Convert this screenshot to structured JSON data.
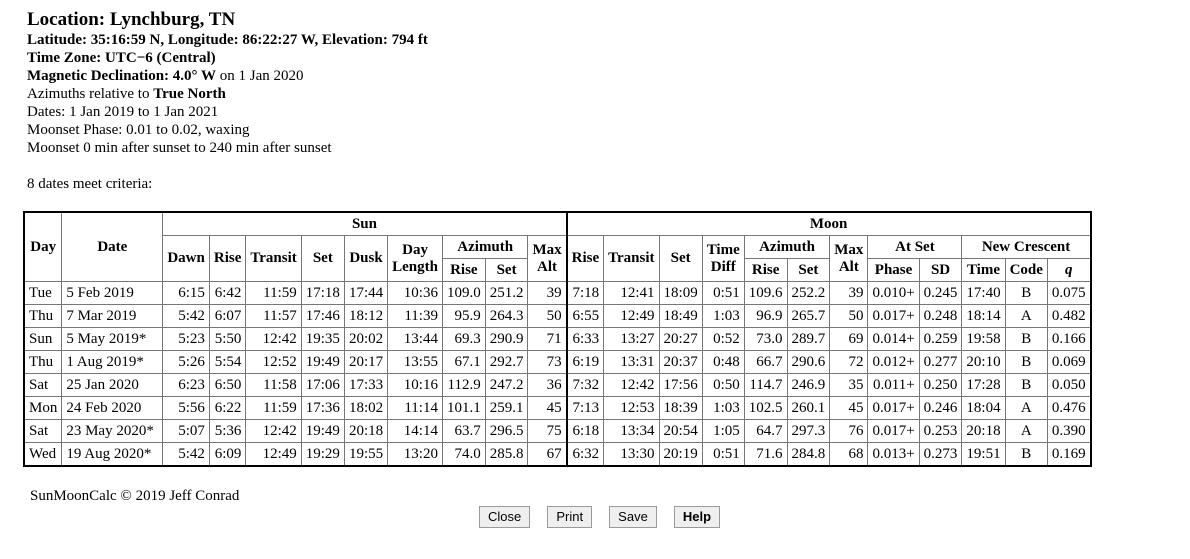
{
  "header": {
    "location": "Location: Lynchburg, TN",
    "coords": "Latitude: 35:16:59 N, Longitude: 86:22:27 W, Elevation: 794 ft",
    "timezone": "Time Zone: UTC−6 (Central)",
    "magdecl_label": "Magnetic Declination: 4.0° W",
    "magdecl_date": " on 1 Jan 2020",
    "azimuth_prefix": "Azimuths relative to ",
    "azimuth_ref": "True North",
    "dates": "Dates: 1 Jan 2019 to 1 Jan 2021",
    "moonset_phase": "Moonset Phase: 0.01 to 0.02, waxing",
    "moonset_window": "Moonset 0 min after sunset to 240 min after sunset"
  },
  "criteria": "8 dates meet criteria:",
  "table": {
    "groups": {
      "sun": "Sun",
      "moon": "Moon"
    },
    "headers": {
      "day": "Day",
      "date": "Date",
      "dawn": "Dawn",
      "rise": "Rise",
      "transit": "Transit",
      "set": "Set",
      "dusk": "Dusk",
      "day_length": [
        "Day",
        "Length"
      ],
      "azimuth": "Azimuth",
      "az_rise": "Rise",
      "az_set": "Set",
      "max_alt": [
        "Max",
        "Alt"
      ],
      "m_rise": "Rise",
      "m_transit": "Transit",
      "m_set": "Set",
      "time_diff": [
        "Time",
        "Diff"
      ],
      "m_azimuth": "Azimuth",
      "m_az_rise": "Rise",
      "m_az_set": "Set",
      "m_max_alt": [
        "Max",
        "Alt"
      ],
      "at_set": "At Set",
      "phase": "Phase",
      "sd": "SD",
      "new_crescent": "New Crescent",
      "nc_time": "Time",
      "nc_code": "Code",
      "nc_q": "q"
    },
    "rows": [
      [
        "Tue",
        "5 Feb 2019",
        "6:15",
        "6:42",
        "11:59",
        "17:18",
        "17:44",
        "10:36",
        "109.0",
        "251.2",
        "39",
        "7:18",
        "12:41",
        "18:09",
        "0:51",
        "109.6",
        "252.2",
        "39",
        "0.010+",
        "0.245",
        "17:40",
        "B",
        "0.075"
      ],
      [
        "Thu",
        "7 Mar 2019",
        "5:42",
        "6:07",
        "11:57",
        "17:46",
        "18:12",
        "11:39",
        "95.9",
        "264.3",
        "50",
        "6:55",
        "12:49",
        "18:49",
        "1:03",
        "96.9",
        "265.7",
        "50",
        "0.017+",
        "0.248",
        "18:14",
        "A",
        "0.482"
      ],
      [
        "Sun",
        "5 May 2019*",
        "5:23",
        "5:50",
        "12:42",
        "19:35",
        "20:02",
        "13:44",
        "69.3",
        "290.9",
        "71",
        "6:33",
        "13:27",
        "20:27",
        "0:52",
        "73.0",
        "289.7",
        "69",
        "0.014+",
        "0.259",
        "19:58",
        "B",
        "0.166"
      ],
      [
        "Thu",
        "1 Aug 2019*",
        "5:26",
        "5:54",
        "12:52",
        "19:49",
        "20:17",
        "13:55",
        "67.1",
        "292.7",
        "73",
        "6:19",
        "13:31",
        "20:37",
        "0:48",
        "66.7",
        "290.6",
        "72",
        "0.012+",
        "0.277",
        "20:10",
        "B",
        "0.069"
      ],
      [
        "Sat",
        "25 Jan 2020",
        "6:23",
        "6:50",
        "11:58",
        "17:06",
        "17:33",
        "10:16",
        "112.9",
        "247.2",
        "36",
        "7:32",
        "12:42",
        "17:56",
        "0:50",
        "114.7",
        "246.9",
        "35",
        "0.011+",
        "0.250",
        "17:28",
        "B",
        "0.050"
      ],
      [
        "Mon",
        "24 Feb 2020",
        "5:56",
        "6:22",
        "11:59",
        "17:36",
        "18:02",
        "11:14",
        "101.1",
        "259.1",
        "45",
        "7:13",
        "12:53",
        "18:39",
        "1:03",
        "102.5",
        "260.1",
        "45",
        "0.017+",
        "0.246",
        "18:04",
        "A",
        "0.476"
      ],
      [
        "Sat",
        "23 May 2020*",
        "5:07",
        "5:36",
        "12:42",
        "19:49",
        "20:18",
        "14:14",
        "63.7",
        "296.5",
        "75",
        "6:18",
        "13:34",
        "20:54",
        "1:05",
        "64.7",
        "297.3",
        "76",
        "0.017+",
        "0.253",
        "20:18",
        "A",
        "0.390"
      ],
      [
        "Wed",
        "19 Aug 2020*",
        "5:42",
        "6:09",
        "12:49",
        "19:29",
        "19:55",
        "13:20",
        "74.0",
        "285.8",
        "67",
        "6:32",
        "13:30",
        "20:19",
        "0:51",
        "71.6",
        "284.8",
        "68",
        "0.013+",
        "0.273",
        "19:51",
        "B",
        "0.169"
      ]
    ]
  },
  "footer": "SunMoonCalc © 2019 Jeff Conrad",
  "buttons": {
    "close": "Close",
    "print": "Print",
    "save": "Save",
    "help": "Help"
  }
}
